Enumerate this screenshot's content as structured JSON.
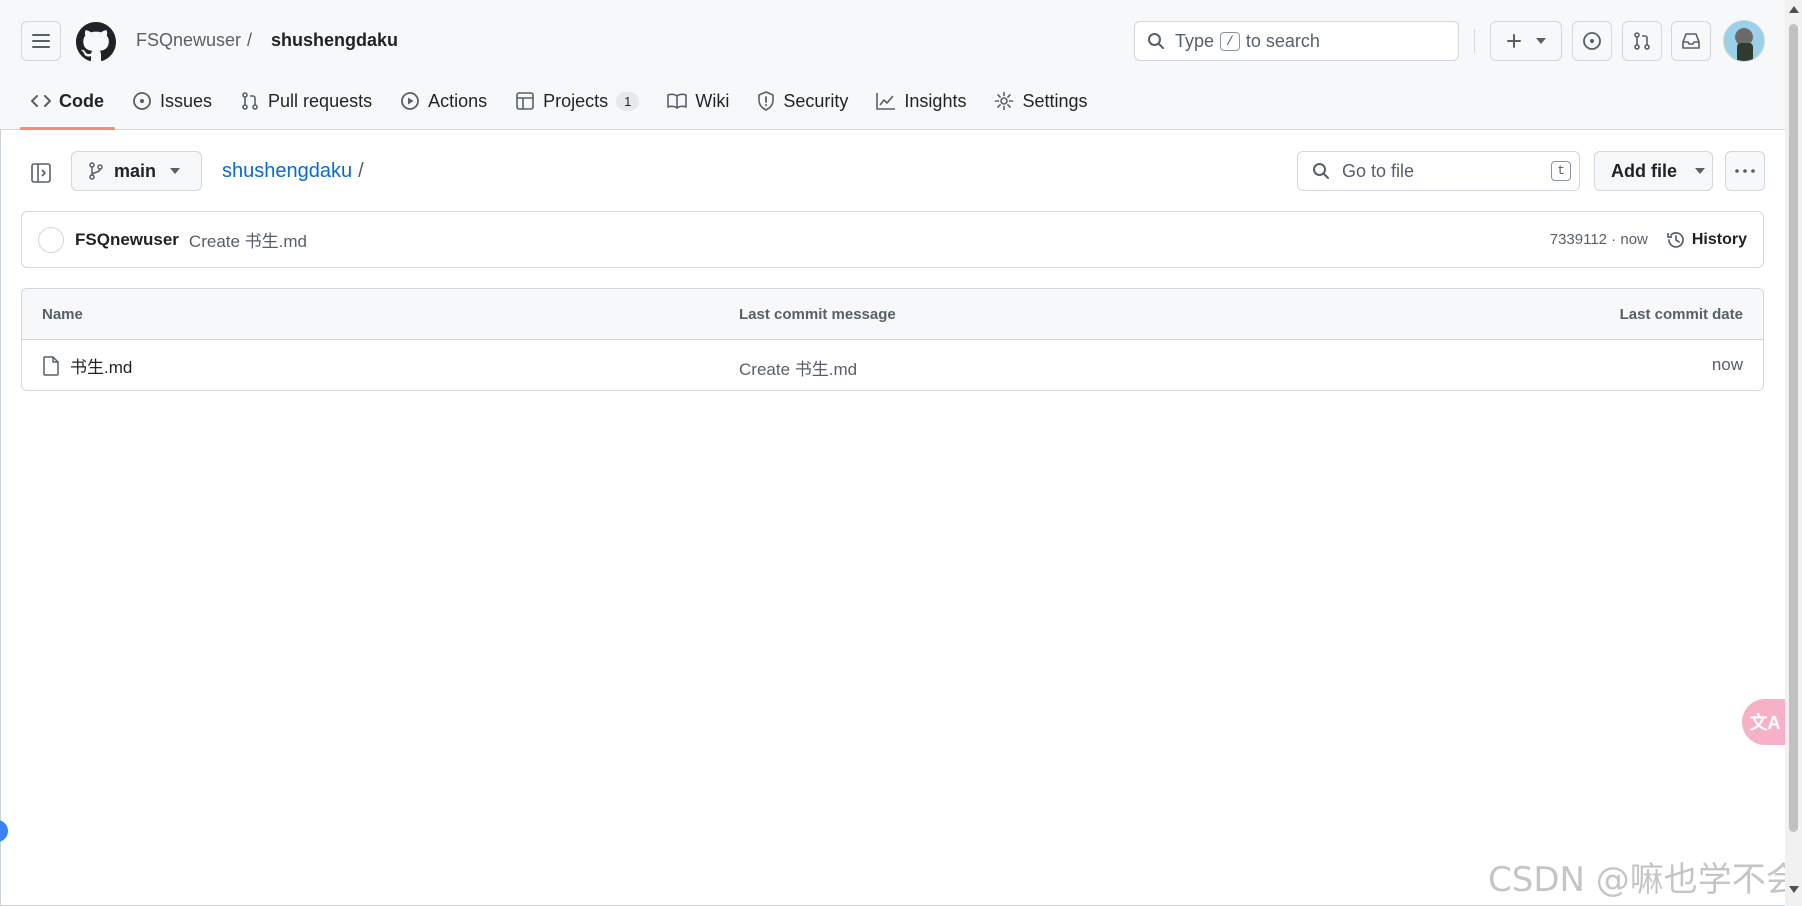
{
  "header": {
    "owner": "FSQnewuser",
    "separator": "/",
    "repo": "shushengdaku",
    "search": {
      "prefix": "Type",
      "key": "/",
      "suffix": "to search"
    }
  },
  "tabs": [
    {
      "label": "Code",
      "icon": "code-icon",
      "active": true
    },
    {
      "label": "Issues",
      "icon": "issue-icon"
    },
    {
      "label": "Pull requests",
      "icon": "pull-request-icon"
    },
    {
      "label": "Actions",
      "icon": "play-icon"
    },
    {
      "label": "Projects",
      "icon": "table-icon",
      "count": "1"
    },
    {
      "label": "Wiki",
      "icon": "book-icon"
    },
    {
      "label": "Security",
      "icon": "shield-icon"
    },
    {
      "label": "Insights",
      "icon": "graph-icon"
    },
    {
      "label": "Settings",
      "icon": "gear-icon"
    }
  ],
  "repo_bar": {
    "branch": "main",
    "path_root": "shushengdaku",
    "path_sep": "/",
    "go_to_file_placeholder": "Go to file",
    "go_to_file_key": "t",
    "add_file_label": "Add file"
  },
  "commit": {
    "author": "FSQnewuser",
    "message": "Create 书生.md",
    "hash_time": "7339112 · now",
    "history_label": "History"
  },
  "table": {
    "columns": [
      "Name",
      "Last commit message",
      "Last commit date"
    ],
    "rows": [
      {
        "name": "书生.md",
        "message": "Create 书生.md",
        "date": "now"
      }
    ]
  },
  "overlay": {
    "translate_label": "文A",
    "watermark": "CSDN @嘛也学不会"
  },
  "colors": {
    "accent_tab_underline": "#fd8c73",
    "link_blue": "#0969da",
    "header_bg": "#f6f8fa",
    "border": "#d0d7de"
  }
}
